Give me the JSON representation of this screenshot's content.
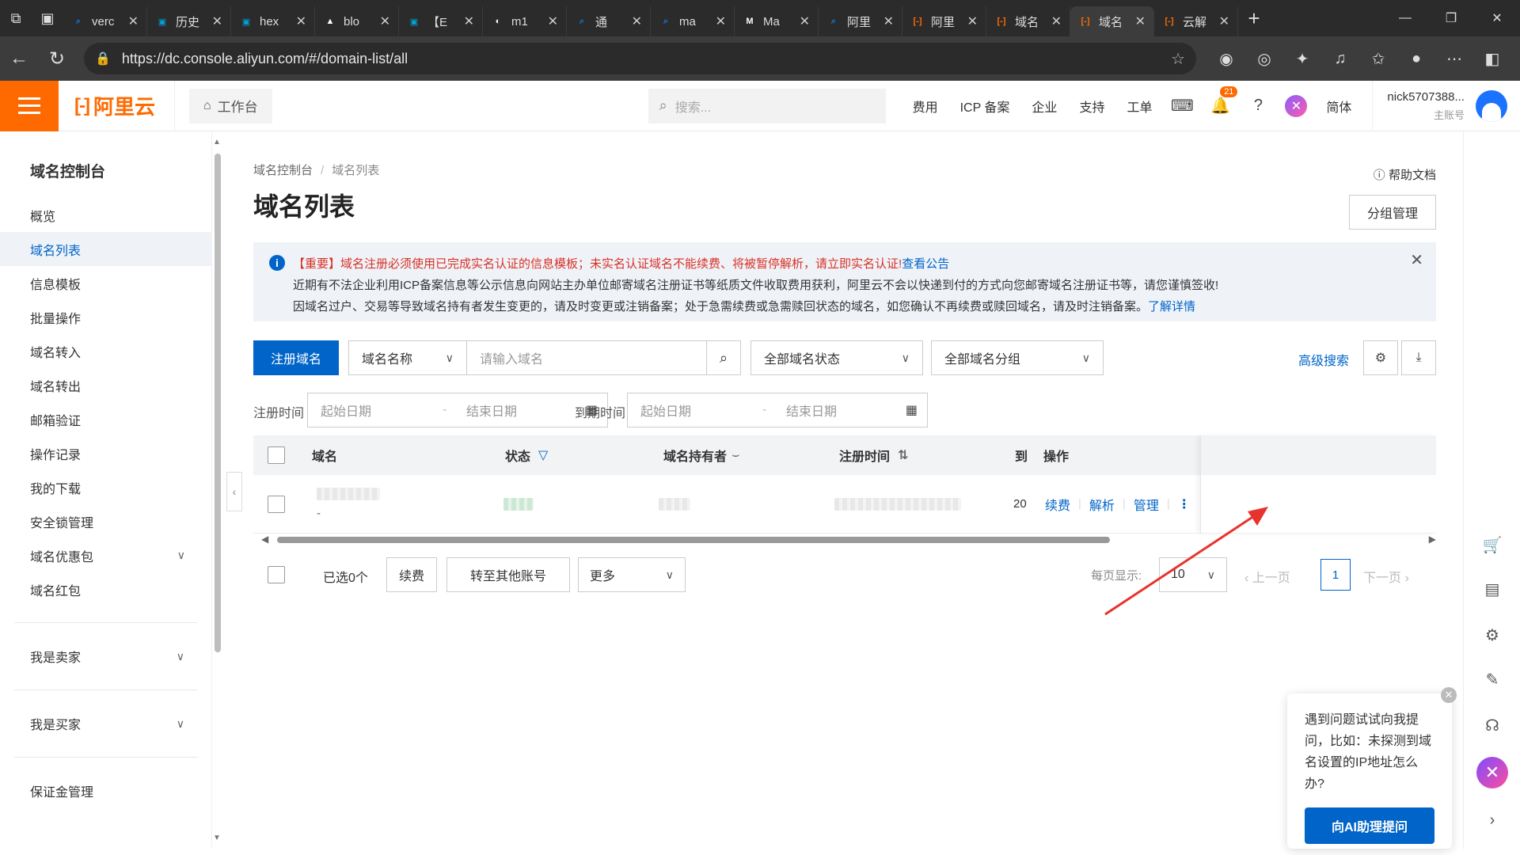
{
  "browser": {
    "tabs": [
      {
        "title": "verc",
        "icon": "search-icon",
        "color": "#1a73e8"
      },
      {
        "title": "历史",
        "icon": "bilibili-icon",
        "color": "#00a1d6"
      },
      {
        "title": "hex",
        "icon": "bilibili-icon",
        "color": "#00a1d6"
      },
      {
        "title": "blo",
        "icon": "vercel-icon",
        "color": "#ffffff"
      },
      {
        "title": "【E",
        "icon": "bilibili-icon",
        "color": "#00a1d6"
      },
      {
        "title": "m1",
        "icon": "github-icon",
        "color": "#ffffff"
      },
      {
        "title": "通",
        "icon": "search-icon",
        "color": "#1a73e8"
      },
      {
        "title": "ma",
        "icon": "search-icon",
        "color": "#1a73e8"
      },
      {
        "title": "Ma",
        "icon": "medium-icon",
        "color": "#ffffff"
      },
      {
        "title": "阿里",
        "icon": "search-icon",
        "color": "#1a73e8"
      },
      {
        "title": "阿里",
        "icon": "aliyun-icon",
        "color": "#ff6a00"
      },
      {
        "title": "域名",
        "icon": "aliyun-icon",
        "color": "#ff6a00"
      },
      {
        "title": "域名",
        "icon": "aliyun-icon",
        "color": "#ff6a00",
        "active": true
      },
      {
        "title": "云解",
        "icon": "aliyun-icon",
        "color": "#ff6a00"
      }
    ],
    "url": "https://dc.console.aliyun.com/#/domain-list/all"
  },
  "header": {
    "brand": "阿里云",
    "workbench": "工作台",
    "search_placeholder": "搜索...",
    "links": [
      "费用",
      "ICP 备案",
      "企业",
      "支持",
      "工单"
    ],
    "notification_count": "21",
    "lang": "简体",
    "account_name": "nick5707388...",
    "account_role": "主账号"
  },
  "sidebar": {
    "title": "域名控制台",
    "items": [
      {
        "label": "概览"
      },
      {
        "label": "域名列表",
        "active": true
      },
      {
        "label": "信息模板"
      },
      {
        "label": "批量操作"
      },
      {
        "label": "域名转入"
      },
      {
        "label": "域名转出"
      },
      {
        "label": "邮箱验证"
      },
      {
        "label": "操作记录"
      },
      {
        "label": "我的下载"
      },
      {
        "label": "安全锁管理"
      },
      {
        "label": "域名优惠包",
        "expandable": true
      },
      {
        "label": "域名红包"
      }
    ],
    "groups": [
      "我是卖家",
      "我是买家",
      "保证金管理"
    ]
  },
  "main": {
    "breadcrumb": [
      "域名控制台",
      "域名列表"
    ],
    "title": "域名列表",
    "help_doc": "帮助文档",
    "group_manage": "分组管理",
    "notice": {
      "line1": "【重要】域名注册必须使用已完成实名认证的信息模板；未实名认证域名不能续费、将被暂停解析，请立即实名认证!",
      "line1_link": "查看公告",
      "line2": "近期有不法企业利用ICP备案信息等公示信息向网站主办单位邮寄域名注册证书等纸质文件收取费用获利，阿里云不会以快递到付的方式向您邮寄域名注册证书等，请您谨慎签收!",
      "line3": "因域名过户、交易等导致域名持有者发生变更的，请及时变更或注销备案；处于急需续费或急需赎回状态的域名，如您确认不再续费或赎回域名，请及时注销备案。",
      "line3_link": "了解详情"
    },
    "toolbar": {
      "register": "注册域名",
      "field_select": "域名名称",
      "search_placeholder": "请输入域名",
      "status_select": "全部域名状态",
      "group_select": "全部域名分组",
      "advanced_search": "高级搜索"
    },
    "dates": {
      "reg_label": "注册时间",
      "exp_label": "到期时间",
      "start": "起始日期",
      "end": "结束日期"
    },
    "table": {
      "headers": [
        "域名",
        "状态",
        "域名持有者",
        "注册时间",
        "到",
        "操作"
      ],
      "row": {
        "expire_partial": "20",
        "second_line": "-",
        "actions": [
          "续费",
          "解析",
          "管理"
        ]
      }
    },
    "footer": {
      "selected": "已选0个",
      "renew": "续费",
      "transfer": "转至其他账号",
      "more": "更多",
      "page_size_label": "每页显示:",
      "page_size": "10",
      "prev": "上一页",
      "current_page": "1",
      "next": "下一页"
    }
  },
  "ai_tip": {
    "text": "遇到问题试试向我提问，比如：未探测到域名设置的IP地址怎么办?",
    "button": "向AI助理提问"
  },
  "colors": {
    "brand_orange": "#ff6a00",
    "primary_blue": "#0064c8",
    "annotation_red": "#e8322d"
  }
}
